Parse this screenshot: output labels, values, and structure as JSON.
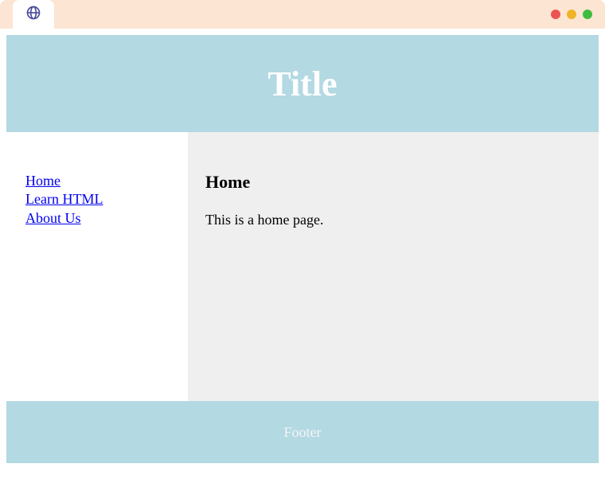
{
  "chrome": {
    "tab_icon": "globe-icon"
  },
  "header": {
    "title": "Title"
  },
  "sidebar": {
    "links": [
      {
        "label": "Home"
      },
      {
        "label": "Learn HTML"
      },
      {
        "label": "About Us"
      }
    ]
  },
  "content": {
    "heading": "Home",
    "body": "This is a home page."
  },
  "footer": {
    "text": "Footer"
  }
}
